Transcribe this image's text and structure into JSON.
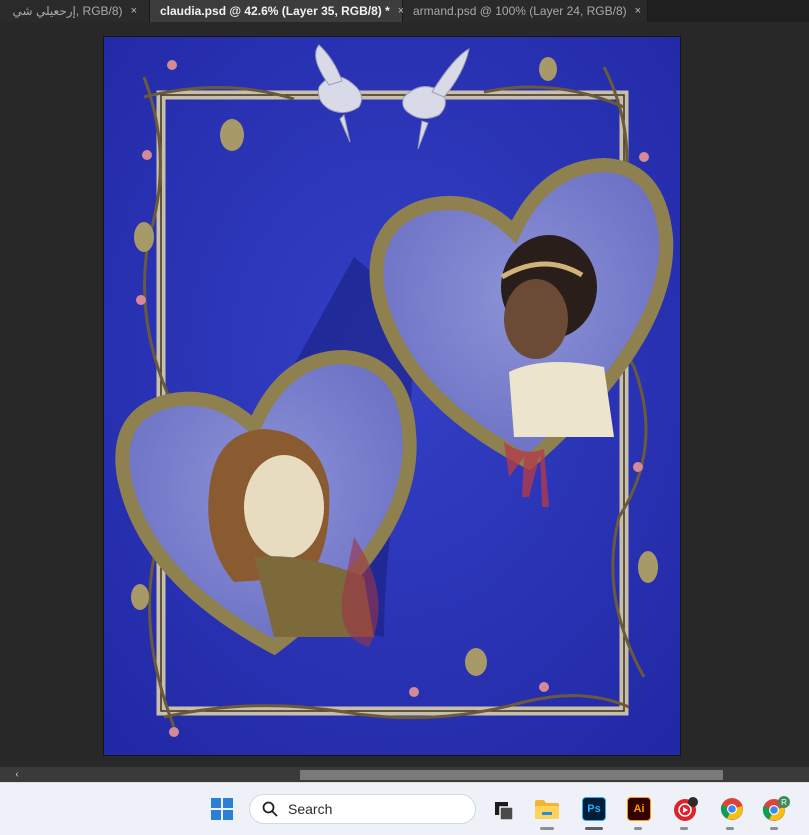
{
  "tabs": [
    {
      "label": "إرحعيلي شي, RGB/8)",
      "active": false
    },
    {
      "label": "claudia.psd @ 42.6% (Layer 35, RGB/8) *",
      "active": true
    },
    {
      "label": "armand.psd @ 100% (Layer 24, RGB/8)",
      "active": false
    }
  ],
  "tab_close_glyph": "×",
  "canvas": {
    "artwork": "illustration",
    "background_color": "#2a33b8",
    "frame_color": "#d9cfa8",
    "heart_frame_color": "#8f8050"
  },
  "scrollbar": {
    "left_arrow": "‹"
  },
  "taskbar": {
    "search_placeholder": "Search",
    "ps_label": "Ps",
    "ai_label": "Ai",
    "profile_badge": "R",
    "icons": [
      "windows-start-icon",
      "search-icon",
      "task-view-icon",
      "file-explorer-icon",
      "photoshop-icon",
      "illustrator-icon",
      "youtube-music-icon",
      "chrome-icon",
      "chrome-profile-icon"
    ],
    "accent_ps": "#31a8ff",
    "accent_ai": "#ff9a00"
  }
}
